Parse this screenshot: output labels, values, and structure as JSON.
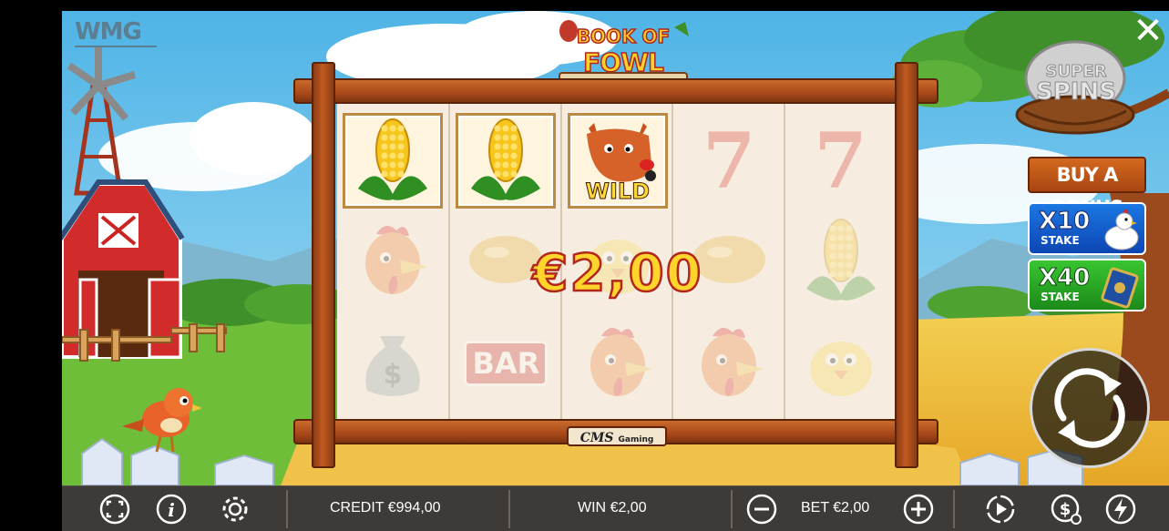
{
  "app": {
    "brand": "WMG",
    "title_line1": "BOOK OF",
    "title_line2": "FOWL PLAY",
    "provider_name": "CMS",
    "provider_suffix": "Gaming"
  },
  "reels": {
    "win_amount": "€2,00",
    "columns": [
      [
        {
          "symbol": "corn",
          "state": "win"
        },
        {
          "symbol": "rooster",
          "state": "dim"
        },
        {
          "symbol": "money-bag",
          "state": "dim"
        }
      ],
      [
        {
          "symbol": "corn",
          "state": "win"
        },
        {
          "symbol": "egg",
          "state": "dim"
        },
        {
          "symbol": "bar",
          "state": "dim",
          "label": "BAR"
        }
      ],
      [
        {
          "symbol": "wolf-wild",
          "state": "win",
          "label": "WILD"
        },
        {
          "symbol": "chick",
          "state": "dim"
        },
        {
          "symbol": "rooster",
          "state": "dim"
        }
      ],
      [
        {
          "symbol": "seven",
          "state": "dim",
          "label": "7"
        },
        {
          "symbol": "egg",
          "state": "dim"
        },
        {
          "symbol": "rooster",
          "state": "dim"
        }
      ],
      [
        {
          "symbol": "seven",
          "state": "dim",
          "label": "7"
        },
        {
          "symbol": "corn",
          "state": "dim"
        },
        {
          "symbol": "chick",
          "state": "dim"
        }
      ]
    ]
  },
  "side": {
    "super_spins_line1": "SUPER",
    "super_spins_line2": "SPINS",
    "buy_bonus_label": "BUY A BONUS",
    "bonus_options": [
      {
        "multiplier": "X10",
        "stake": "STAKE",
        "icon": "chicken-icon"
      },
      {
        "multiplier": "X40",
        "stake": "STAKE",
        "icon": "book-icon"
      }
    ]
  },
  "bottom_bar": {
    "credit_label": "CREDIT",
    "credit_value": "€994,00",
    "win_label": "WIN",
    "win_value": "€2,00",
    "bet_label": "BET",
    "bet_value": "€2,00",
    "icons": [
      "fullscreen-icon",
      "info-icon",
      "settings-icon",
      "minus-icon",
      "plus-icon",
      "autoplay-icon",
      "coin-settings-icon",
      "turbo-icon"
    ]
  },
  "colors": {
    "win_text": "#ffd42b",
    "win_stroke": "#b3261c",
    "bottom_bar": "#3e3a38",
    "buy_bonus": "#d46a1f",
    "x10_button": "#1c77e2",
    "x40_button": "#39c531"
  }
}
